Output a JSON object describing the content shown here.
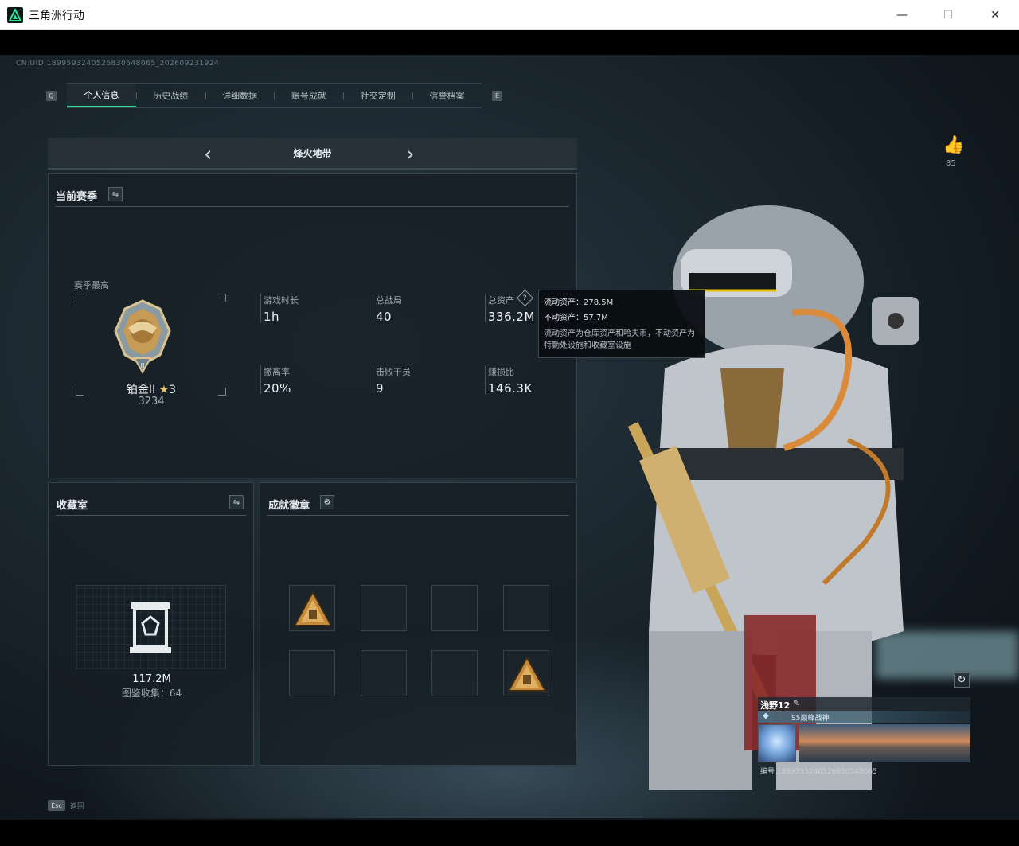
{
  "window": {
    "title": "三角洲行动",
    "minimize": "—",
    "maximize": "☐",
    "close": "✕"
  },
  "uid": "CN:UID 1899593240526830548065_202609231924",
  "tabs": {
    "left_key": "Q",
    "right_key": "E",
    "items": [
      {
        "label": "个人信息",
        "active": true
      },
      {
        "label": "历史战绩",
        "active": false
      },
      {
        "label": "详细数据",
        "active": false
      },
      {
        "label": "账号成就",
        "active": false
      },
      {
        "label": "社交定制",
        "active": false
      },
      {
        "label": "信誉档案",
        "active": false
      }
    ]
  },
  "mode": {
    "title": "烽火地带"
  },
  "season": {
    "heading": "当前赛季",
    "best_label": "赛季最高",
    "rank_name": "铂金II",
    "rank_stars": "3",
    "rank_score": "3234",
    "stats": [
      {
        "label": "游戏时长",
        "value": "1h"
      },
      {
        "label": "总战局",
        "value": "40"
      },
      {
        "label": "总资产",
        "value": "336.2M"
      },
      {
        "label": "撤离率",
        "value": "20%"
      },
      {
        "label": "击败干员",
        "value": "9"
      },
      {
        "label": "赚损比",
        "value": "146.3K"
      }
    ]
  },
  "tooltip": {
    "liquid": "流动资产：278.5M",
    "fixed": "不动资产：57.7M",
    "desc": "流动资产为仓库资产和哈夫币，不动资产为特勤处设施和收藏室设施"
  },
  "collection": {
    "heading": "收藏室",
    "value": "117.2M",
    "count_label": "图鉴收集：64"
  },
  "achievements": {
    "heading": "成就徽章",
    "slots": [
      true,
      false,
      false,
      false,
      false,
      false,
      false,
      true
    ]
  },
  "likes": {
    "count": "85"
  },
  "esc": {
    "key": "Esc",
    "label": "返回"
  },
  "player": {
    "name": "浅野12",
    "title": "S5巅峰战神",
    "id_label": "编号 1899593240526830548065"
  },
  "colors": {
    "accent": "#2fe09b",
    "gold": "#c9a55a",
    "panel": "#161e24"
  }
}
